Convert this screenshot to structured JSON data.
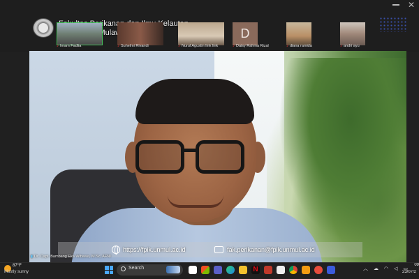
{
  "meeting": {
    "org_title_line1": "Fakultas Perikanan dan Ilmu Kelautan",
    "org_title_line2": "Universitas Mulawarman",
    "participants": [
      {
        "name": "Imam Fadlia"
      },
      {
        "name": "Suhelmi Rivandi"
      },
      {
        "name": "Nurul Agustin link link"
      },
      {
        "name": "Daisy Rahma Rizal",
        "initial": "D"
      },
      {
        "name": "diana ramida"
      },
      {
        "name": "andri ayu"
      }
    ],
    "speaker_name": "Dr. Capt. Bambang Eka Wibawa, M.Sc, AFNI"
  },
  "banner": {
    "website": "https://fpik.unmul.ac.id",
    "email": "fak.perikanan@fpik.unmul.ac.id"
  },
  "taskbar": {
    "weather_temp": "87°F",
    "weather_desc": "Mostly sunny",
    "search_placeholder": "Search",
    "clock_time": "09",
    "clock_date": "23/07/2"
  },
  "colors": {
    "active_speaker_border": "#46c15b",
    "mic_muted": "#e33333",
    "start_blue": "#4aa8ff"
  }
}
